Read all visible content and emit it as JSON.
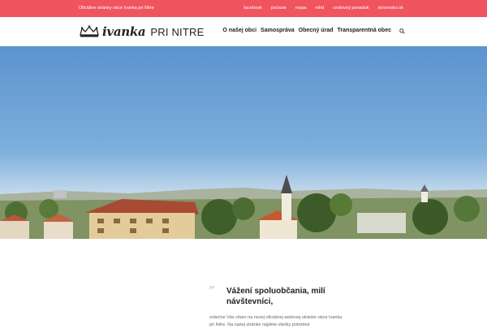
{
  "topbar": {
    "tagline": "Oficiálne stránky obce Ivanka pri Nitre",
    "links": [
      "facebook",
      "počasie",
      "mapa",
      "mhd",
      "cestovný poriadok",
      "slovensko.sk"
    ]
  },
  "header": {
    "logo_script": "ivanka",
    "logo_caps": "PRI NITRE",
    "nav": [
      "O našej obci",
      "Samospráva",
      "Obecný úrad",
      "Transparentná obec"
    ]
  },
  "welcome": {
    "title": "Vážení spoluobčania, milí návštevníci,",
    "body": "srdečne Vás vítam na novej oficiálnej webovej stránke obce Ivanka pri Nitre. Na našej stránke nájdete všetky potrebné"
  },
  "colors": {
    "topbar": "#f0545f",
    "sky_top": "#5b93cf",
    "sky_bottom": "#cfe0ee"
  },
  "icons": {
    "logo": "crown-icon",
    "search": "search-icon"
  }
}
